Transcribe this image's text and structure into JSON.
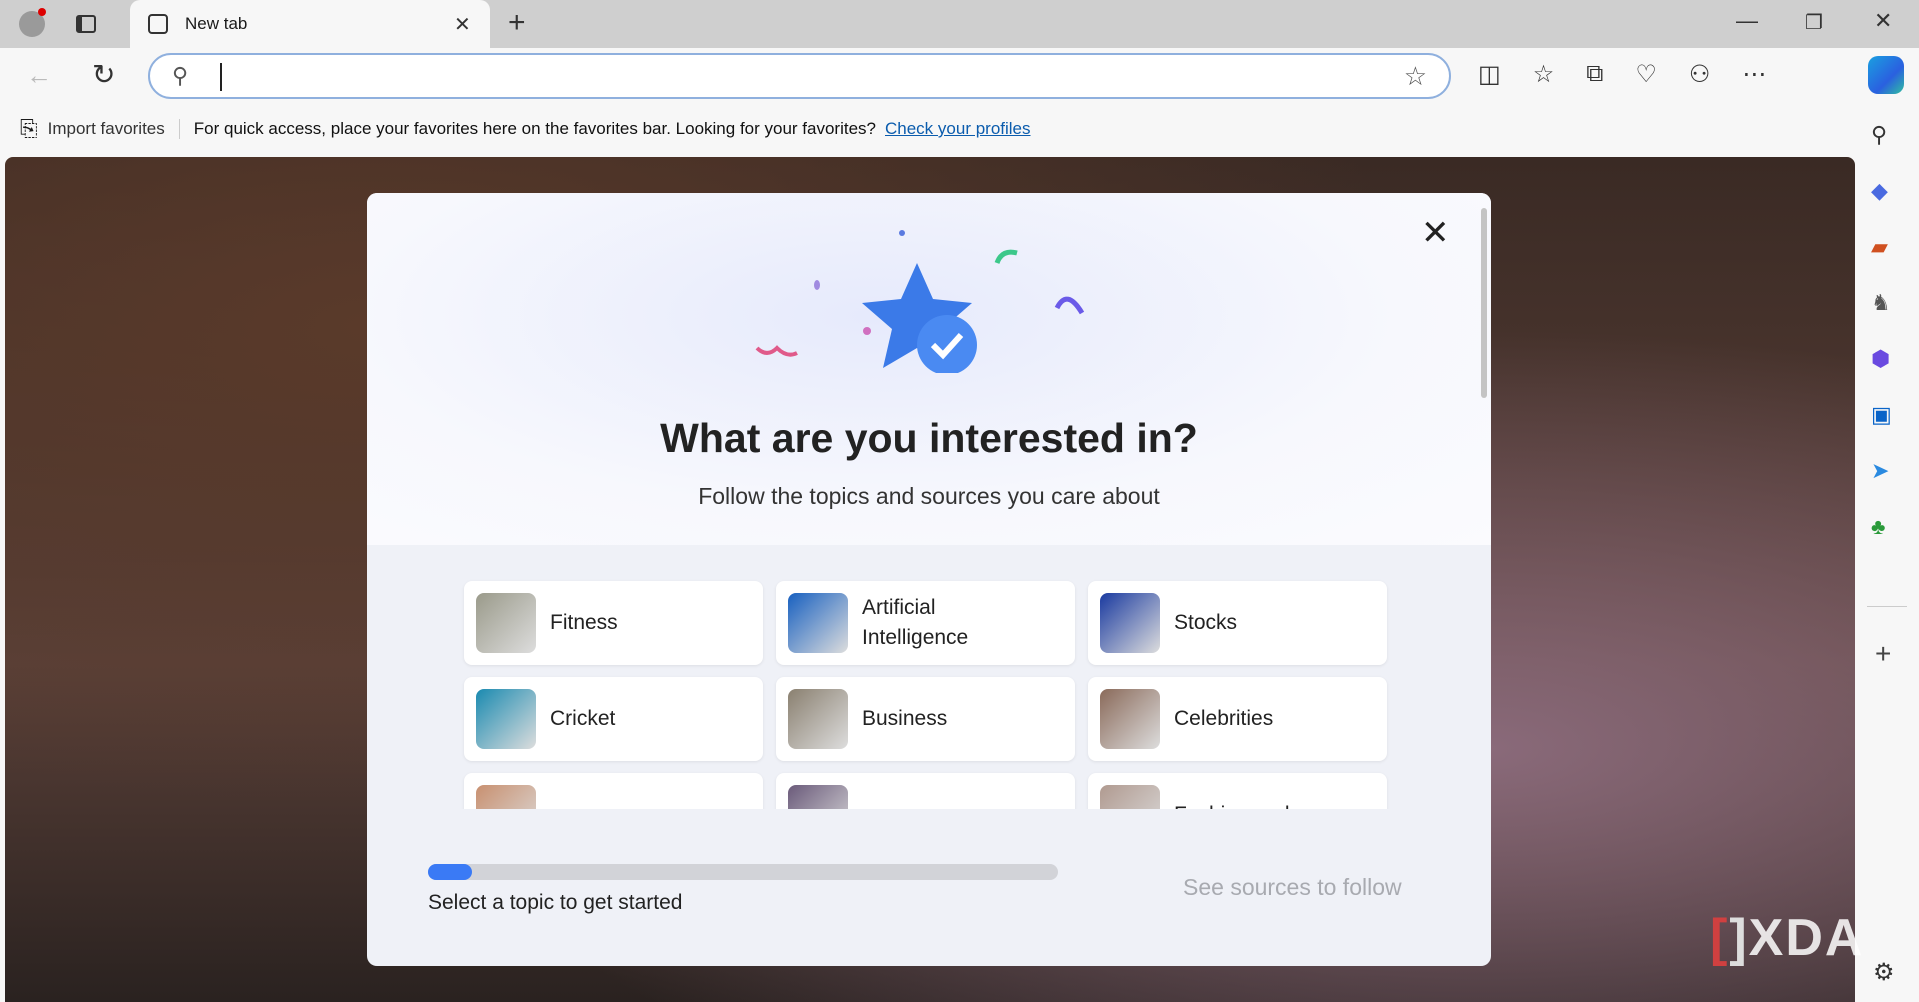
{
  "browser": {
    "tab_title": "New tab",
    "address_value": "",
    "favorites_bar": {
      "import_label": "Import favorites",
      "message": "For quick access, place your favorites here on the favorites bar. Looking for your favorites?",
      "link": "Check your profiles"
    }
  },
  "modal": {
    "title": "What are you interested in?",
    "subtitle": "Follow the topics and sources you care about",
    "topics": [
      {
        "label": "Fitness",
        "color": "#9a9a8a"
      },
      {
        "label": "Artificial Intelligence",
        "color": "#1860c0"
      },
      {
        "label": "Stocks",
        "color": "#1a3aa0"
      },
      {
        "label": "Cricket",
        "color": "#1a8ab0"
      },
      {
        "label": "Business",
        "color": "#8a8070"
      },
      {
        "label": "Celebrities",
        "color": "#8a6a5a"
      },
      {
        "label": "",
        "color": "#c89070"
      },
      {
        "label": "",
        "color": "#6a5a7a"
      },
      {
        "label": "Fashion and",
        "color": "#b09a90"
      }
    ],
    "progress": 0.07,
    "status": "Select a topic to get started",
    "next_button": "See sources to follow"
  },
  "watermark": "XDA"
}
